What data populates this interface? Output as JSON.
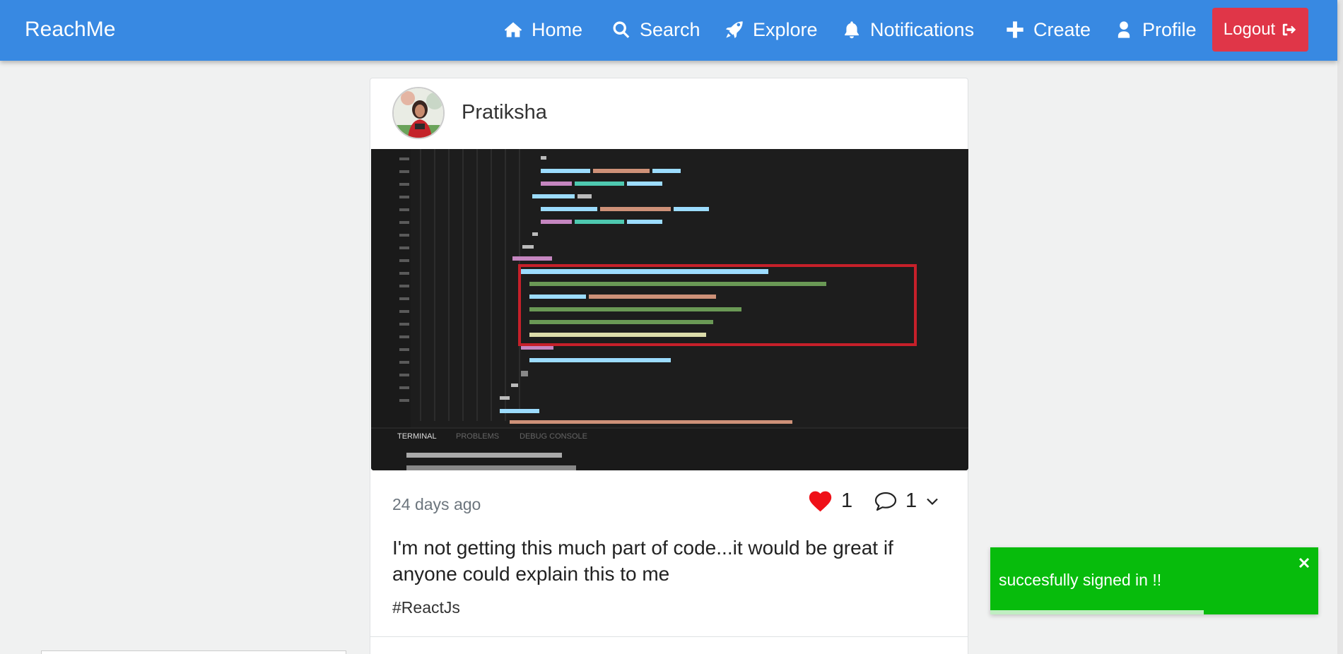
{
  "navbar": {
    "brand": "ReachMe",
    "items": [
      {
        "label": "Home",
        "icon": "home-icon"
      },
      {
        "label": "Search",
        "icon": "search-icon"
      },
      {
        "label": "Explore",
        "icon": "rocket-icon"
      },
      {
        "label": "Notifications",
        "icon": "bell-icon"
      },
      {
        "label": "Create",
        "icon": "plus-icon"
      },
      {
        "label": "Profile",
        "icon": "user-icon"
      }
    ],
    "logout_label": "Logout",
    "logout_icon": "sign-out-icon",
    "color": "#3889e2",
    "logout_color": "#e03648"
  },
  "post": {
    "username": "Pratiksha",
    "time": "24 days ago",
    "likes": "1",
    "comments": "1",
    "caption": "I'm not getting this much part of code...it would be great if anyone could explain this to me",
    "hashtag": "#ReactJs",
    "image_panel_tabs": [
      "TERMINAL",
      "PROBLEMS",
      "DEBUG CONSOLE"
    ],
    "heart_color": "#ef1018"
  },
  "toast": {
    "message": "succesfully signed in !!",
    "progress": 0.65,
    "color": "#07bc0c"
  }
}
